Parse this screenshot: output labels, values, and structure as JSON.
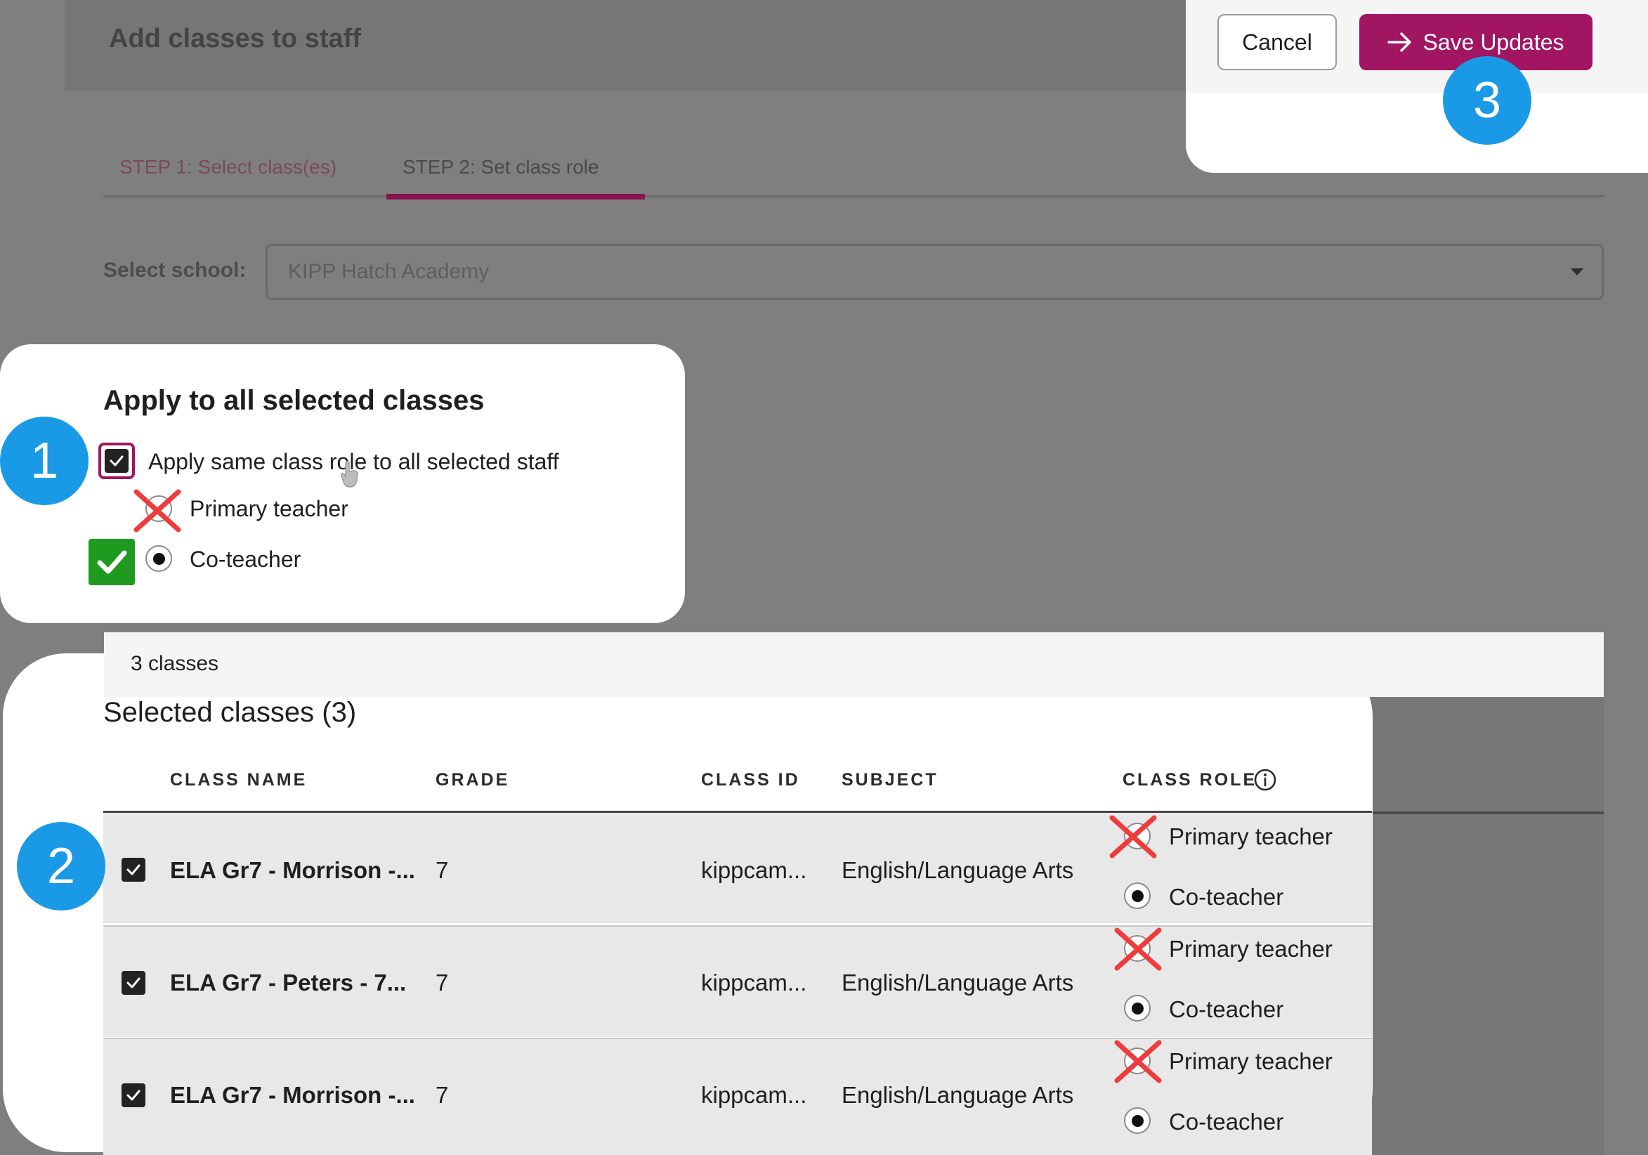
{
  "page": {
    "title": "Add classes to staff",
    "steps": [
      {
        "label": "STEP 1: Select class(es)"
      },
      {
        "label": "STEP 2: Set class role"
      }
    ],
    "school_label": "Select school:",
    "school_value": "KIPP Hatch Academy"
  },
  "actions": {
    "cancel_label": "Cancel",
    "save_label": "Save Updates"
  },
  "badges": [
    "1",
    "2",
    "3"
  ],
  "apply_all": {
    "title": "Apply to all selected classes",
    "checkbox_label": "Apply same class role to all selected staff",
    "checkbox_checked": true,
    "options": [
      {
        "label": "Primary teacher",
        "selected": false
      },
      {
        "label": "Co-teacher",
        "selected": true
      }
    ]
  },
  "classes": {
    "count_text": "3 classes",
    "title": "Selected classes (3)",
    "columns": [
      "CLASS NAME",
      "GRADE",
      "CLASS ID",
      "SUBJECT",
      "CLASS ROLE"
    ],
    "rows": [
      {
        "name": "ELA Gr7 - Morrison -...",
        "grade": "7",
        "class_id": "kippcam...",
        "subject": "English/Language Arts",
        "role_primary": "Primary teacher",
        "role_co": "Co-teacher",
        "selected_role": "Co-teacher"
      },
      {
        "name": "ELA Gr7 - Peters - 7...",
        "grade": "7",
        "class_id": "kippcam...",
        "subject": "English/Language Arts",
        "role_primary": "Primary teacher",
        "role_co": "Co-teacher",
        "selected_role": "Co-teacher"
      },
      {
        "name": "ELA Gr7 - Morrison -...",
        "grade": "7",
        "class_id": "kippcam...",
        "subject": "English/Language Arts",
        "role_primary": "Primary teacher",
        "role_co": "Co-teacher",
        "selected_role": "Co-teacher"
      }
    ]
  },
  "colors": {
    "accent": "#a11563",
    "badge": "#1a9ae6",
    "overlay": "#7f7f7f",
    "cross_mark": "#ef3b3b",
    "check_mark": "#1e9b1e"
  },
  "icons": [
    "arrow-right-icon",
    "info-icon",
    "checkmark-icon",
    "red-cross-icon",
    "green-check-icon",
    "cursor-icon"
  ]
}
